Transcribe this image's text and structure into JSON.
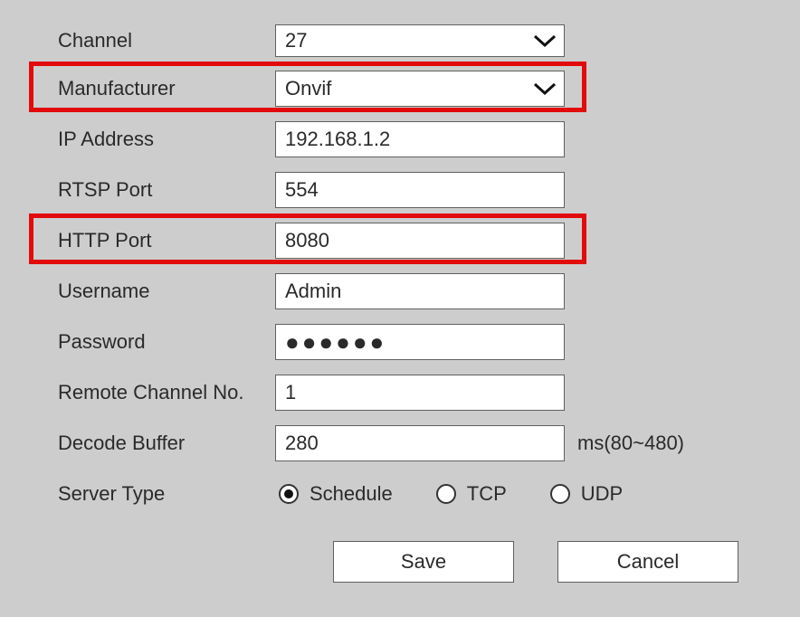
{
  "labels": {
    "channel": "Channel",
    "manufacturer": "Manufacturer",
    "ip_address": "IP Address",
    "rtsp_port": "RTSP Port",
    "http_port": "HTTP Port",
    "username": "Username",
    "password": "Password",
    "remote_channel_no": "Remote Channel No.",
    "decode_buffer": "Decode Buffer",
    "server_type": "Server Type"
  },
  "values": {
    "channel": "27",
    "manufacturer": "Onvif",
    "ip_address": "192.168.1.2",
    "rtsp_port": "554",
    "http_port": "8080",
    "username": "Admin",
    "password_mask": "●●●●●●",
    "remote_channel_no": "1",
    "decode_buffer": "280"
  },
  "suffix": {
    "decode_buffer": "ms(80~480)"
  },
  "server_type_options": {
    "schedule": "Schedule",
    "tcp": "TCP",
    "udp": "UDP"
  },
  "server_type_selected": "schedule",
  "buttons": {
    "save": "Save",
    "cancel": "Cancel"
  }
}
